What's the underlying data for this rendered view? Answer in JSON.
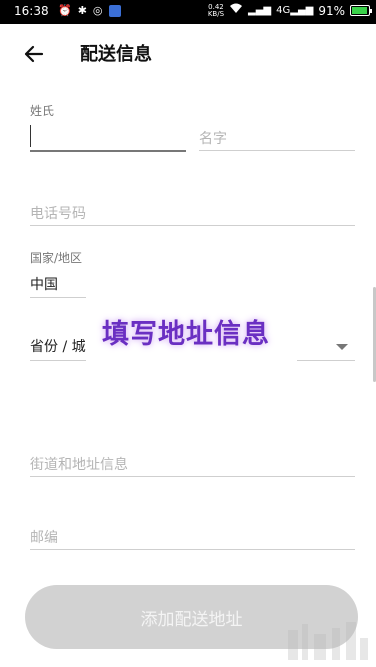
{
  "status_bar": {
    "time": "16:38",
    "net_speed_value": "0.42",
    "net_speed_unit": "KB/S",
    "signal_1": "4G",
    "battery_percent": "91%",
    "battery_level": 0.91,
    "battery_color": "#3ad14a"
  },
  "header": {
    "title": "配送信息"
  },
  "form": {
    "surname_label": "姓氏",
    "given_name_placeholder": "名字",
    "phone_placeholder": "电话号码",
    "country_label": "国家/地区",
    "country_value": "中国",
    "province_label": "省份 / 城",
    "street_placeholder": "街道和地址信息",
    "postcode_placeholder": "邮编"
  },
  "overlay_annotation": "填写地址信息",
  "submit_button": {
    "label": "添加配送地址",
    "background": "#d2d2d2"
  }
}
